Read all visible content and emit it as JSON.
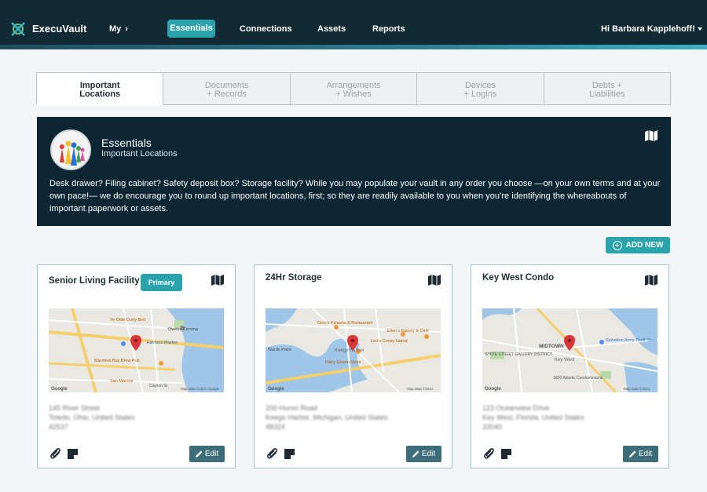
{
  "nav": {
    "brand": "ExecuVault",
    "my": "My",
    "essentials": "Essentials",
    "connections": "Connections",
    "assets": "Assets",
    "reports": "Reports",
    "user": "Hi Barbara Kapplehoff!"
  },
  "tabs": [
    {
      "line1": "Important",
      "line2": "Locations"
    },
    {
      "line1": "Documents",
      "line2": "+ Records"
    },
    {
      "line1": "Arrangements",
      "line2": "+ Wishes"
    },
    {
      "line1": "Devices",
      "line2": "+ Logins"
    },
    {
      "line1": "Debts +",
      "line2": "Liabilities"
    }
  ],
  "hero": {
    "title": "Essentials",
    "subtitle": "Important Locations",
    "description": "Desk drawer? Filing cabinet? Safety deposit box? Storage facility? While you may populate your vault in any order you choose —on your own terms and at your own pace!— we do encourage you to round up important locations, first; so they are readily available to you when you’re identifying the whereabouts of important paperwork or assets."
  },
  "add_new_label": "ADD NEW",
  "cards": [
    {
      "title": "Senior Living Facility",
      "badge": "Primary",
      "address": [
        "145 River Street",
        "Toledo, Ohio, United States",
        "42537"
      ],
      "edit_label": "Edit",
      "map_labels": [
        "Ye Olde Durty Bird",
        "Owens Corning",
        "Farmers Market",
        "Maumee Bay Brew Pub",
        "San Marcos",
        "Clayton St",
        "Google",
        "Map data ©2021 Google"
      ]
    },
    {
      "title": "24Hr Storage",
      "badge": "",
      "address": [
        "200 Huron Road",
        "Keego Harbor, Michigan, United States",
        "48324"
      ],
      "edit_label": "Edit",
      "map_labels": [
        "Gino's Pizzeria & Restaurant",
        "Ellen's Bakery & Cafe",
        "Leo's Coney Island",
        "Wards Point",
        "Keego Harbor",
        "Dairy Queen Store",
        "Google",
        "Map data ©2021"
      ]
    },
    {
      "title": "Key West Condo",
      "badge": "",
      "address": [
        "123 Oceanview Drive",
        "Key West, Florida, United States",
        "33040"
      ],
      "edit_label": "Edit",
      "map_labels": [
        "MIDTOWN",
        "Key West",
        "WHITE STREET GALLERY DISTRICT",
        "Salvation Army Thrift Store",
        "1800 Atlantic Condominiums",
        "Google",
        "Map data ©2021"
      ]
    }
  ],
  "colors": {
    "nav_bg": "#122a36",
    "hero_bg": "#0d2633",
    "accent": "#2ba3ad",
    "edit_btn": "#3d6d7a",
    "map_pin": "#d93838"
  }
}
